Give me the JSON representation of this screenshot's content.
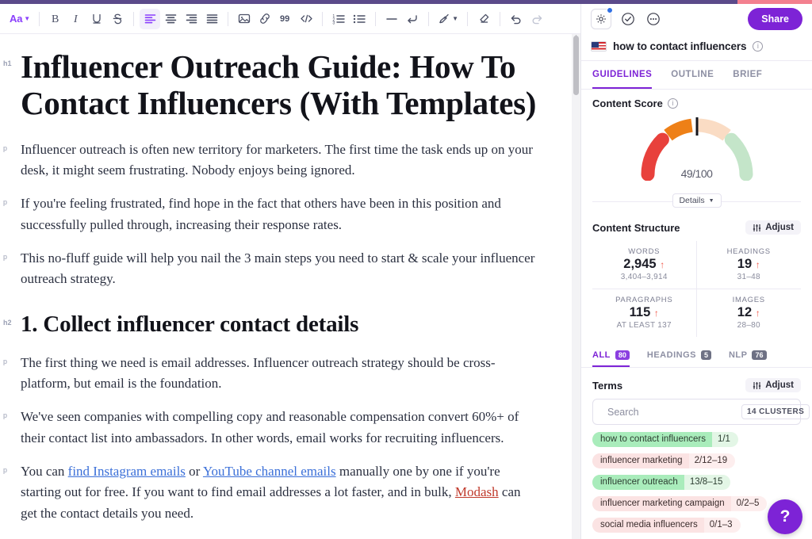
{
  "theme": {
    "accent_purple": "#7d23d6",
    "accent_bar": "#5b4a8a",
    "accent_pink": "#f3808f",
    "link_blue": "#3a6fd8",
    "link_red": "#c0392b",
    "up_arrow_red": "#f0594a"
  },
  "toolbar": {
    "font_label": "Aa",
    "items": [
      {
        "name": "font-style-dropdown",
        "glyph": "Aa"
      },
      {
        "name": "bold-button",
        "glyph": "B"
      },
      {
        "name": "italic-button",
        "glyph": "I"
      },
      {
        "name": "underline-button",
        "glyph": "U"
      },
      {
        "name": "strikethrough-button",
        "glyph": "S"
      },
      {
        "name": "align-left-button",
        "glyph": "align-left"
      },
      {
        "name": "align-center-button",
        "glyph": "align-center"
      },
      {
        "name": "align-right-button",
        "glyph": "align-right"
      },
      {
        "name": "align-justify-button",
        "glyph": "align-justify"
      },
      {
        "name": "insert-image-button",
        "glyph": "image"
      },
      {
        "name": "insert-link-button",
        "glyph": "link"
      },
      {
        "name": "blockquote-button",
        "glyph": "99"
      },
      {
        "name": "code-block-button",
        "glyph": "</>"
      },
      {
        "name": "ordered-list-button",
        "glyph": "ordered-list"
      },
      {
        "name": "bullet-list-button",
        "glyph": "bullet-list"
      },
      {
        "name": "horizontal-rule-button",
        "glyph": "minus"
      },
      {
        "name": "line-break-button",
        "glyph": "return"
      },
      {
        "name": "format-paint-button",
        "glyph": "brush"
      },
      {
        "name": "clear-format-button",
        "glyph": "eraser"
      },
      {
        "name": "undo-button",
        "glyph": "undo"
      },
      {
        "name": "redo-button",
        "glyph": "redo"
      }
    ],
    "quote_glyph": "99",
    "code_glyph": "</>"
  },
  "document": {
    "blocks": [
      {
        "tag": "h1",
        "text": "Influencer Outreach Guide: How To Contact Influencers (With Templates)"
      },
      {
        "tag": "p",
        "text": "Influencer outreach is often new territory for marketers. The first time the task ends up on your desk, it might seem frustrating. Nobody enjoys being ignored."
      },
      {
        "tag": "p",
        "text": "If you're feeling frustrated, find hope in the fact that others have been in this position and successfully pulled through, increasing their response rates."
      },
      {
        "tag": "p",
        "text": "This no-fluff guide will help you nail the 3 main steps you need to start & scale your influencer outreach strategy."
      },
      {
        "tag": "h2",
        "text": "1. Collect influencer contact details"
      },
      {
        "tag": "p",
        "text": "The first thing we need is email addresses. Influencer outreach strategy should be cross-platform, but email is the foundation."
      },
      {
        "tag": "p",
        "text": "We've seen companies with compelling copy and reasonable compensation convert 60%+ of their contact list into ambassadors. In other words, email works for recruiting influencers."
      }
    ],
    "last_paragraph": {
      "tag": "p",
      "part1": "You can ",
      "link1": "find Instagram emails",
      "part2": " or ",
      "link2": "YouTube channel emails",
      "part3": " manually one by one if you're starting out for free. If you want to find email addresses a lot faster, and in bulk, ",
      "link3": "Modash",
      "part4": " can get the contact details you need."
    }
  },
  "panel": {
    "header": {
      "settings_icon": "gear-icon",
      "approve_icon": "check-circle-icon",
      "more_icon": "more-options-icon",
      "share_label": "Share"
    },
    "keyword": {
      "flag": "us-flag",
      "title": "how to contact influencers",
      "info": "info-icon"
    },
    "tabs": [
      {
        "label": "GUIDELINES",
        "active": true
      },
      {
        "label": "OUTLINE",
        "active": false
      },
      {
        "label": "BRIEF",
        "active": false
      }
    ],
    "content_score": {
      "title": "Content Score",
      "value": "49",
      "max": "/100",
      "needle_percent": 49,
      "details_label": "Details",
      "segments": [
        {
          "name": "poor",
          "color": "#e8413c",
          "from": 0,
          "to": 28
        },
        {
          "name": "fair",
          "color": "#ee8017",
          "from": 30,
          "to": 45
        },
        {
          "name": "good",
          "color": "#fadcc4",
          "from": 47,
          "to": 64
        },
        {
          "name": "great",
          "color": "#c4e5c9",
          "from": 66,
          "to": 100
        }
      ]
    },
    "content_structure": {
      "title": "Content Structure",
      "adjust_label": "Adjust",
      "stats": [
        {
          "label": "WORDS",
          "value": "2,945",
          "trend": "up",
          "range": "3,404–3,914"
        },
        {
          "label": "HEADINGS",
          "value": "19",
          "trend": "up",
          "range": "31–48"
        },
        {
          "label": "PARAGRAPHS",
          "value": "115",
          "trend": "up",
          "range": "AT LEAST 137"
        },
        {
          "label": "IMAGES",
          "value": "12",
          "trend": "up",
          "range": "28–80"
        }
      ]
    },
    "term_tabs": [
      {
        "label": "ALL",
        "count": "80",
        "active": true,
        "pill": "purple"
      },
      {
        "label": "HEADINGS",
        "count": "5",
        "active": false,
        "pill": "grey"
      },
      {
        "label": "NLP",
        "count": "76",
        "active": false,
        "pill": "grey"
      }
    ],
    "terms": {
      "title": "Terms",
      "adjust_label": "Adjust",
      "search_placeholder": "Search",
      "search_value": "",
      "clusters_label": "14 CLUSTERS",
      "items": [
        {
          "label": "how to contact influencers",
          "count": "1/1",
          "state": "green"
        },
        {
          "label": "influencer marketing",
          "count": "2/12–19",
          "state": "pink"
        },
        {
          "label": "influencer outreach",
          "count": "13/8–15",
          "state": "green"
        },
        {
          "label": "influencer marketing campaign",
          "count": "0/2–5",
          "state": "pink"
        },
        {
          "label": "social media influencers",
          "count": "0/1–3",
          "state": "pink"
        }
      ]
    },
    "help_label": "?"
  }
}
